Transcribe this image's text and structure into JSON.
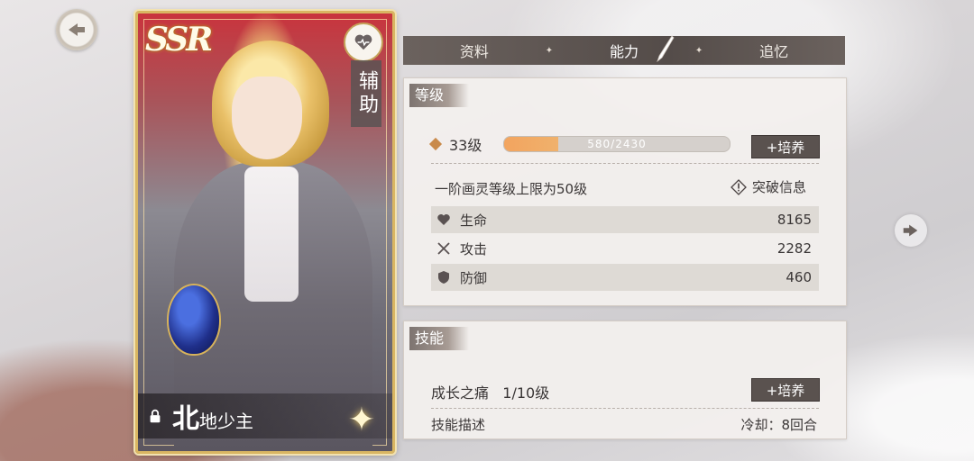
{
  "card": {
    "rarity": "SSR",
    "role": "辅助",
    "name_first": "北",
    "name_rest": "地少主"
  },
  "tabs": [
    {
      "label": "资料"
    },
    {
      "label": "能力"
    },
    {
      "label": "追忆"
    }
  ],
  "level_panel": {
    "title": "等级",
    "level_text": "33级",
    "exp_text": "580/2430",
    "exp_progress": 0.2387,
    "train_label": "+培养",
    "limit_text": "一阶画灵等级上限为50级",
    "break_label": "突破信息",
    "stats": [
      {
        "label": "生命",
        "value": "8165",
        "icon": "heart-icon"
      },
      {
        "label": "攻击",
        "value": "2282",
        "icon": "swords-icon"
      },
      {
        "label": "防御",
        "value": "460",
        "icon": "shield-icon"
      }
    ]
  },
  "skill_panel": {
    "title": "技能",
    "skill_name": "成长之痛",
    "skill_level": "1/10级",
    "train_label": "+培养",
    "desc_label": "技能描述",
    "cooldown": "冷却：8回合"
  },
  "colors": {
    "accent_orange": "#f2a45f",
    "tab_bar": "#544c49",
    "card_border": "#d9b662"
  }
}
